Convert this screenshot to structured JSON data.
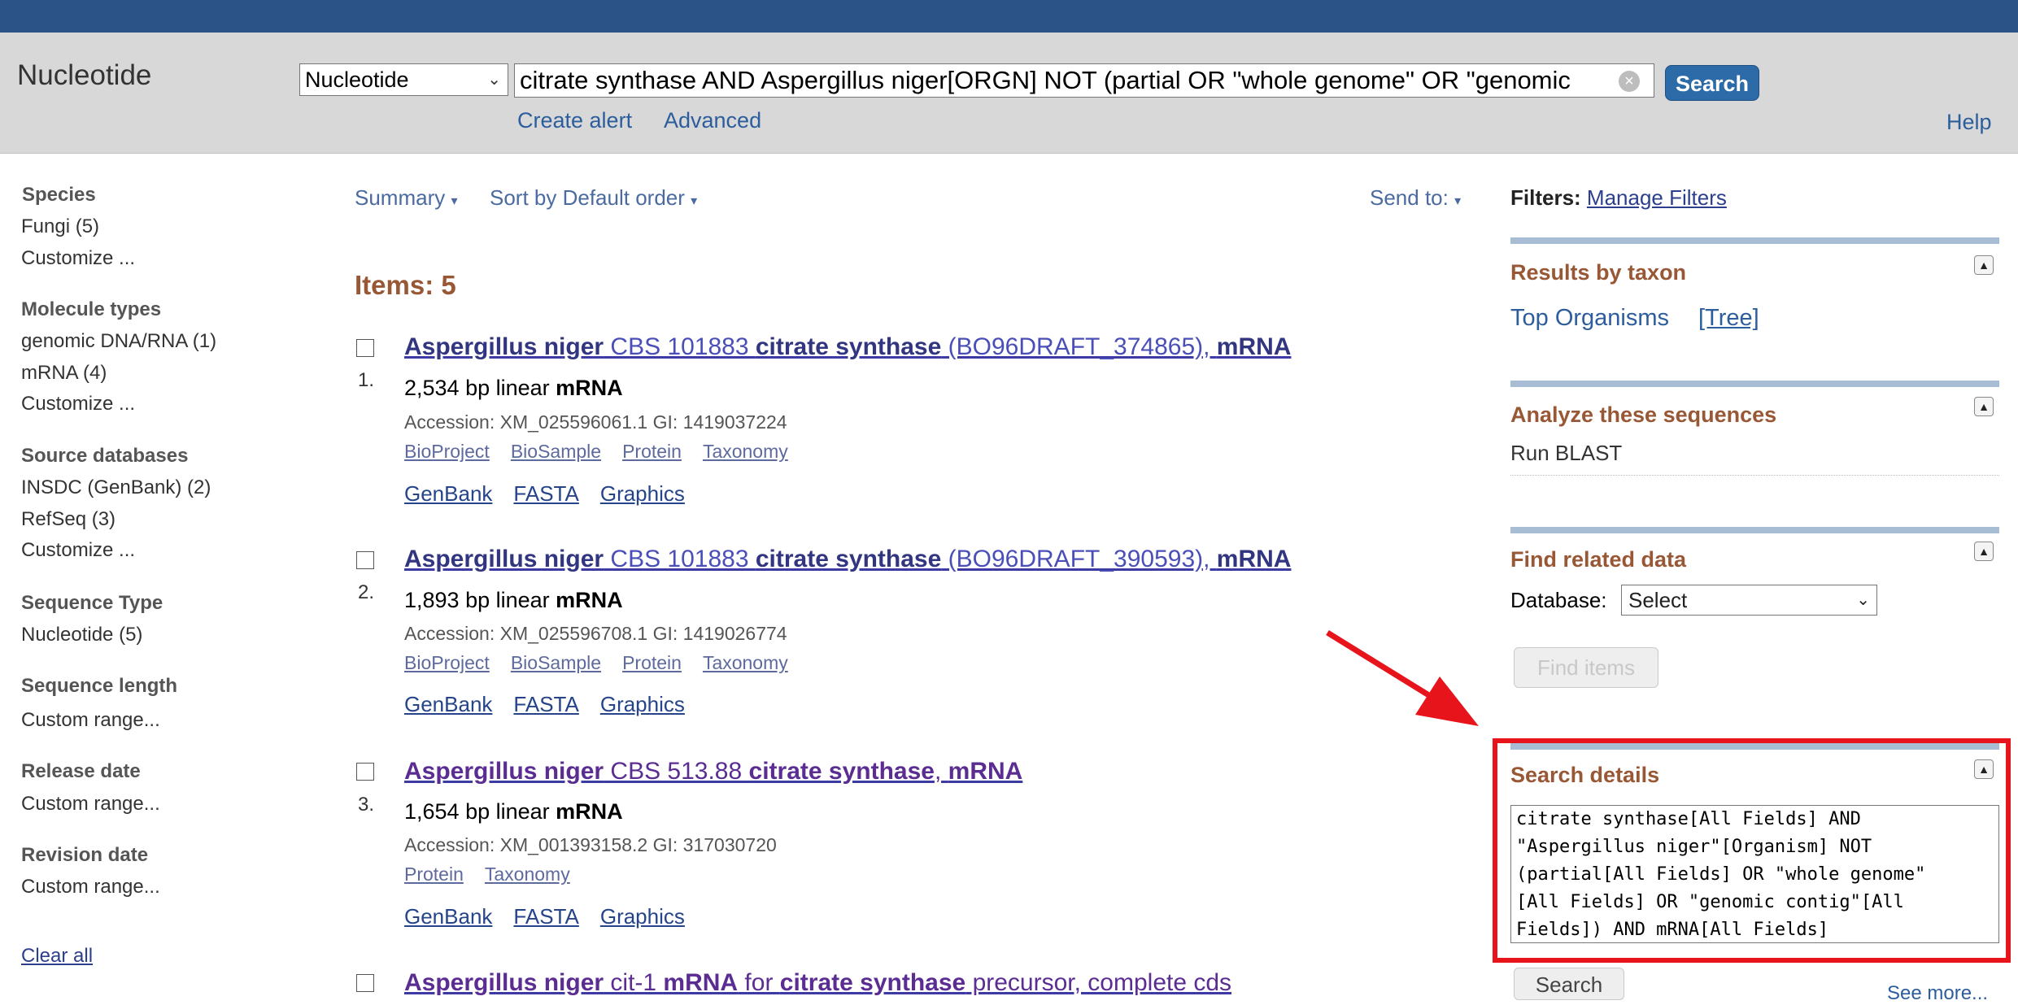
{
  "header": {
    "app_title": "Nucleotide",
    "db_select_value": "Nucleotide",
    "search_query": "citrate synthase AND Aspergillus niger[ORGN] NOT (partial OR \"whole genome\" OR \"genomic",
    "search_button": "Search",
    "create_alert": "Create alert",
    "advanced": "Advanced",
    "help": "Help"
  },
  "sidebar": {
    "groups": [
      {
        "heading": "Species",
        "items": [
          "Fungi (5)",
          "Customize ..."
        ]
      },
      {
        "heading": "Molecule types",
        "items": [
          "genomic DNA/RNA (1)",
          "mRNA (4)",
          "Customize ..."
        ]
      },
      {
        "heading": "Source databases",
        "items": [
          "INSDC (GenBank) (2)",
          "RefSeq (3)",
          "Customize ..."
        ]
      },
      {
        "heading": "Sequence Type",
        "items": [
          "Nucleotide (5)"
        ]
      },
      {
        "heading": "Sequence length",
        "items": [
          "Custom range..."
        ]
      },
      {
        "heading": "Release date",
        "items": [
          "Custom range..."
        ]
      },
      {
        "heading": "Revision date",
        "items": [
          "Custom range..."
        ]
      }
    ],
    "clear_all": "Clear all"
  },
  "toolbar": {
    "summary": "Summary",
    "sort": "Sort by Default order",
    "send_to": "Send to:"
  },
  "results": {
    "items_count": "Items: 5",
    "list": [
      {
        "number": "1.",
        "title_parts": [
          "Aspergillus niger",
          " CBS 101883 ",
          "citrate synthase",
          " (BO96DRAFT_374865), ",
          "mRNA"
        ],
        "bp": "2,534 bp linear ",
        "bp_type": "mRNA",
        "accession": "Accession: XM_025596061.1   GI: 1419037224",
        "sublinks": [
          "BioProject",
          "BioSample",
          "Protein",
          "Taxonomy"
        ],
        "formats": [
          "GenBank",
          "FASTA",
          "Graphics"
        ]
      },
      {
        "number": "2.",
        "title_parts": [
          "Aspergillus niger",
          " CBS 101883 ",
          "citrate synthase",
          " (BO96DRAFT_390593), ",
          "mRNA"
        ],
        "bp": "1,893 bp linear ",
        "bp_type": "mRNA",
        "accession": "Accession: XM_025596708.1   GI: 1419026774",
        "sublinks": [
          "BioProject",
          "BioSample",
          "Protein",
          "Taxonomy"
        ],
        "formats": [
          "GenBank",
          "FASTA",
          "Graphics"
        ]
      },
      {
        "number": "3.",
        "title_parts": [
          "Aspergillus niger",
          " CBS 513.88 ",
          "citrate synthase",
          ", ",
          "mRNA"
        ],
        "bp": "1,654 bp linear ",
        "bp_type": "mRNA",
        "accession": "Accession: XM_001393158.2   GI: 317030720",
        "sublinks": [
          "Protein",
          "Taxonomy"
        ],
        "formats": [
          "GenBank",
          "FASTA",
          "Graphics"
        ]
      },
      {
        "title_parts": [
          "Aspergillus niger",
          " cit-1 ",
          "mRNA",
          " for ",
          "citrate synthase",
          " precursor, complete cds"
        ]
      }
    ]
  },
  "right": {
    "filters_label": "Filters:",
    "manage_filters": "Manage Filters",
    "results_by_taxon": "Results by taxon",
    "top_organisms": "Top Organisms",
    "tree": "[Tree]",
    "analyze": "Analyze these sequences",
    "run_blast": "Run BLAST",
    "find_related": "Find related data",
    "database_label": "Database:",
    "database_value": "Select",
    "find_items": "Find items",
    "search_details": "Search details",
    "details_lines": [
      "citrate synthase[All Fields] AND",
      "\"Aspergillus niger\"[Organism] NOT",
      "(partial[All Fields] OR \"whole genome\"",
      "[All Fields] OR \"genomic contig\"[All",
      "Fields]) AND mRNA[All Fields]"
    ],
    "search_button": "Search",
    "see_more": "See more..."
  },
  "annotation": {
    "arrow_color": "#e8141b",
    "frame_color": "#e8141b"
  }
}
